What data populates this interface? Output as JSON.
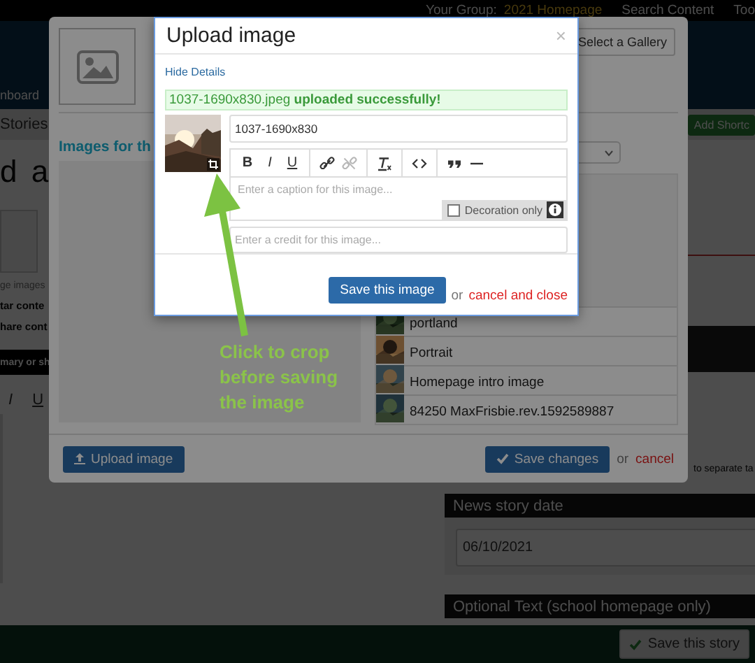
{
  "top_bar": {
    "group_label": "Your Group:",
    "group_name": "2021 Homepage",
    "links": [
      "Search Content",
      "Too"
    ]
  },
  "page": {
    "nav_item": "nboard",
    "tab": "Stories",
    "shortcut_button": "Add Shortc",
    "heading": "d a",
    "image_caption": "ge images",
    "options": [
      "tar conte",
      "hare cont"
    ],
    "summary_bar": "mary or sh",
    "editor_toolbar": [
      "I",
      "U"
    ],
    "tag_hint": "to separate ta",
    "date_panel": {
      "title": "News story date",
      "value": "06/10/2021"
    },
    "optional_panel": {
      "title": "Optional Text (school homepage only)"
    },
    "save_story_button": "Save this story"
  },
  "gallery_modal": {
    "gallery_button": "Select a Gallery",
    "section_title": "Images for th",
    "images": [
      {
        "name": "portland",
        "kind": "picture"
      },
      {
        "name": "Portrait",
        "kind": "picture"
      },
      {
        "name": "Homepage intro image",
        "kind": "picture"
      },
      {
        "name": "84250 MaxFrisbie.rev.1592589887",
        "kind": "picture"
      }
    ],
    "upload_button": "Upload image",
    "save_button": "Save changes",
    "or": "or",
    "cancel_link": "cancel"
  },
  "upload_modal": {
    "title": "Upload image",
    "close": "×",
    "toggle_link": "Hide Details",
    "success_message": "1037-1690x830.jpeg **uploaded successfully!**",
    "filename": "1037-1690x830",
    "toolbar_groups": [
      [
        {
          "kind": "bold",
          "label": "B",
          "disabled": false
        },
        {
          "kind": "italic",
          "label": "I",
          "disabled": false
        },
        {
          "kind": "underline",
          "label": "U",
          "disabled": false
        }
      ],
      [
        {
          "kind": "link",
          "disabled": false
        },
        {
          "kind": "unlink",
          "disabled": true
        }
      ],
      [
        {
          "kind": "clear",
          "disabled": false
        }
      ],
      [
        {
          "kind": "code",
          "disabled": false
        }
      ],
      [
        {
          "kind": "quote",
          "disabled": false
        },
        {
          "kind": "rule",
          "disabled": false
        }
      ]
    ],
    "caption_placeholder": "Enter a caption for this image...",
    "decoration": {
      "label": "Decoration only",
      "checked": false
    },
    "credit_placeholder": "Enter a credit for this image...",
    "save_button": "Save this image",
    "or": "or",
    "cancel_link": "cancel and close"
  },
  "annotation": {
    "text": "Click to crop before saving the image"
  }
}
